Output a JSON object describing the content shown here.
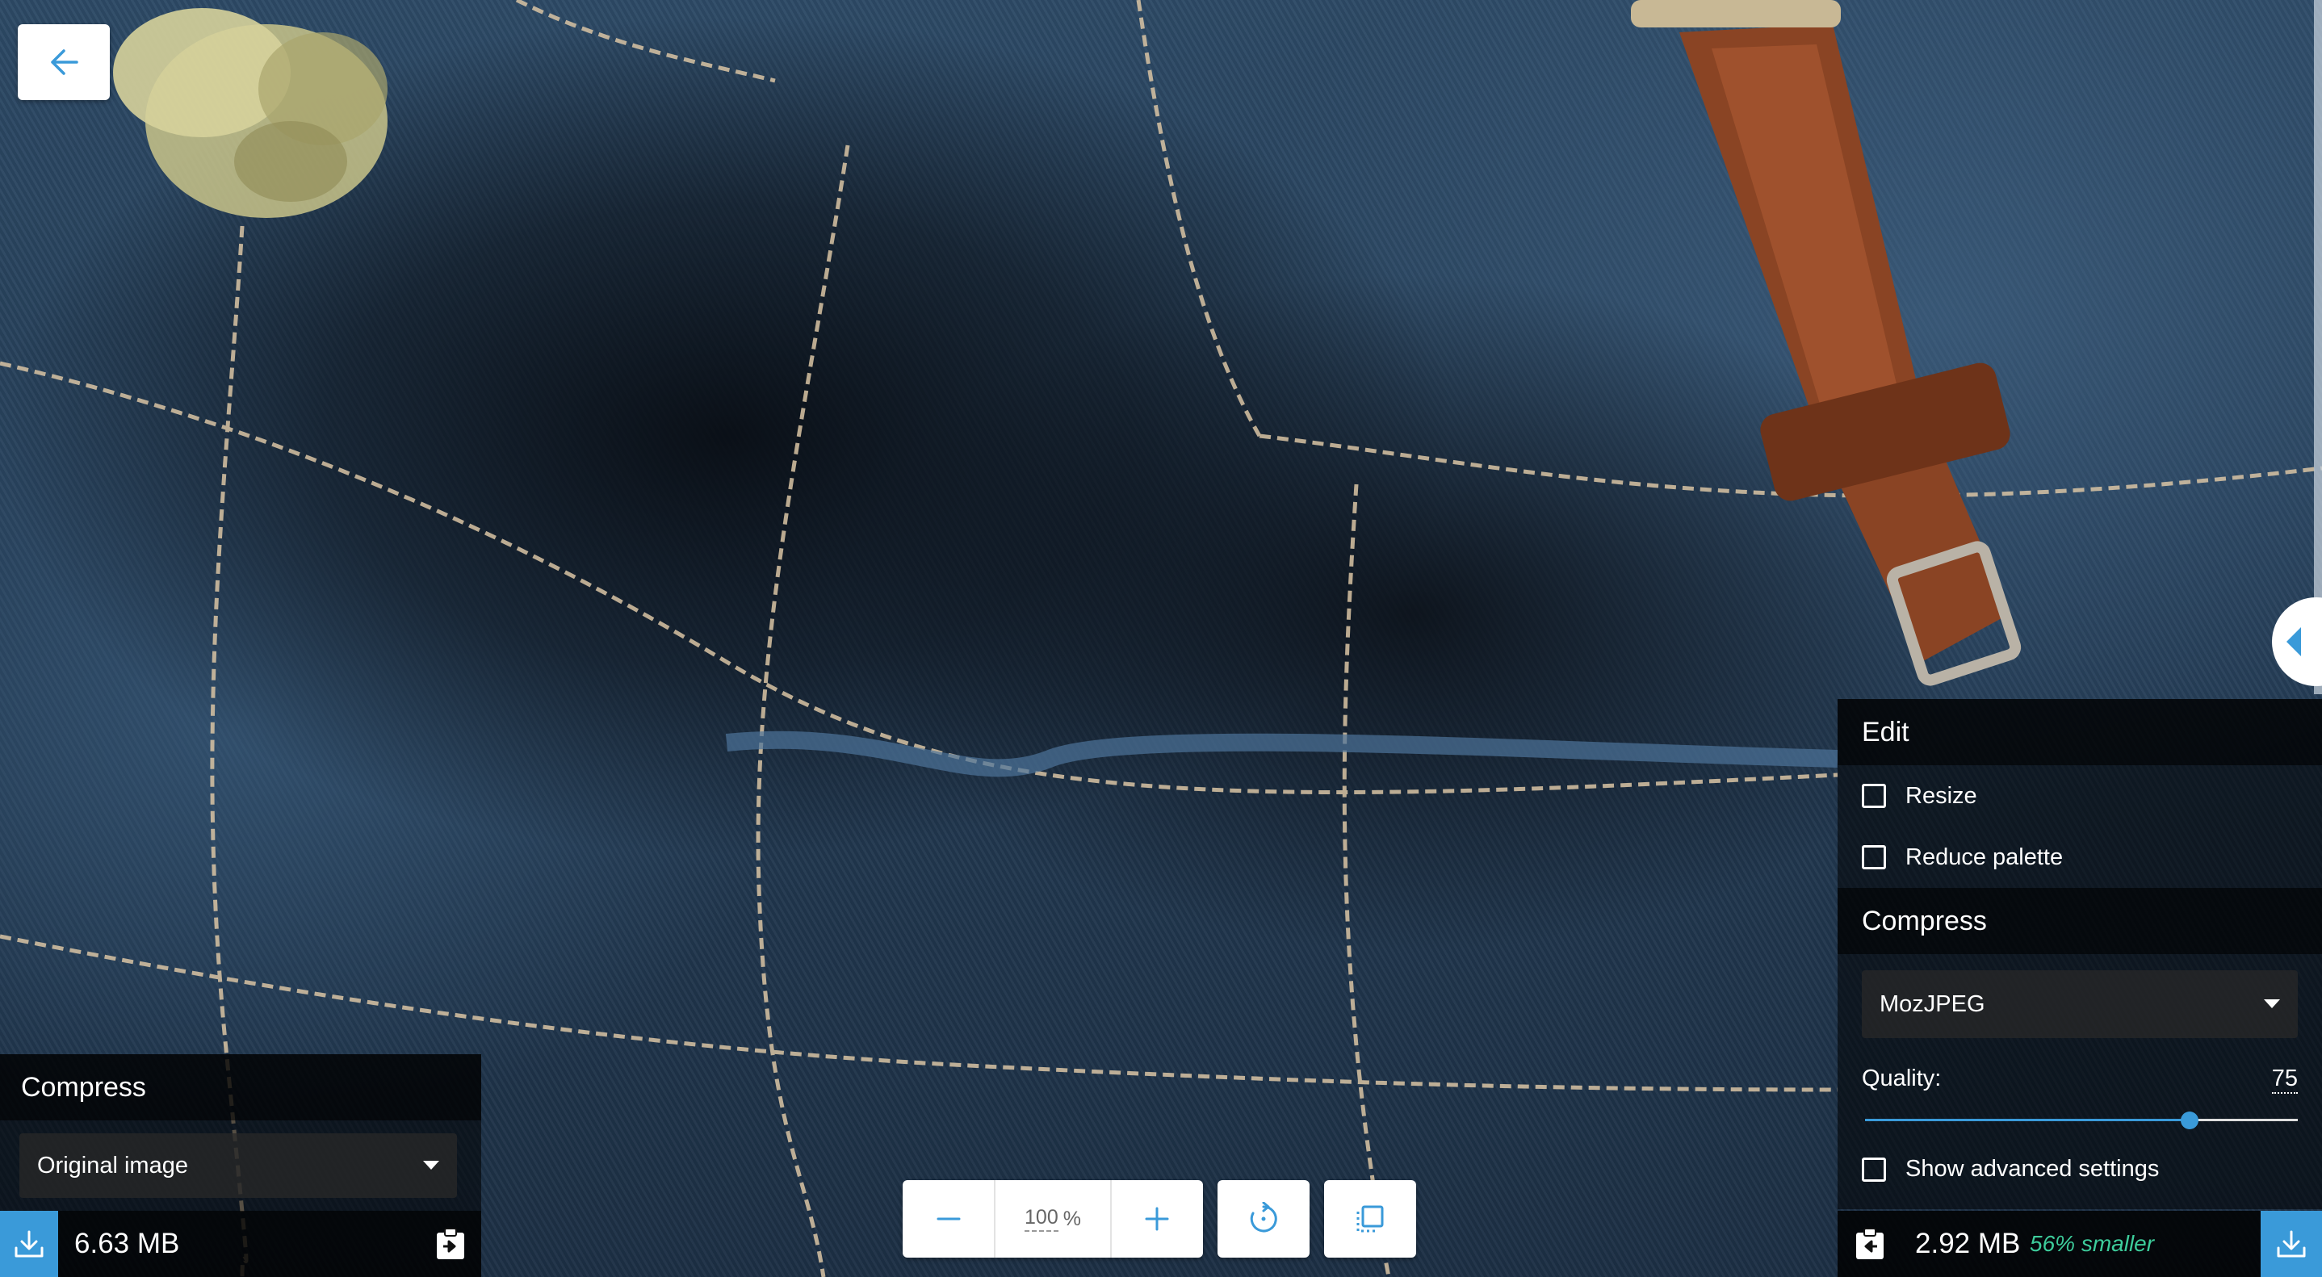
{
  "app": {
    "back_icon": "arrow-left-icon"
  },
  "left_panel": {
    "heading": "Compress",
    "encoder_selected": "Original image",
    "file_size": "6.63 MB"
  },
  "right_panel": {
    "edit_heading": "Edit",
    "options": [
      {
        "label": "Resize",
        "checked": false
      },
      {
        "label": "Reduce palette",
        "checked": false
      }
    ],
    "compress_heading": "Compress",
    "encoder_selected": "MozJPEG",
    "quality_label": "Quality:",
    "quality_value": "75",
    "quality_fraction": 0.75,
    "advanced_label": "Show advanced settings",
    "file_size": "2.92 MB",
    "savings": "56% smaller"
  },
  "toolbar": {
    "zoom_value": "100",
    "zoom_unit": "%",
    "icons": [
      "minus-icon",
      "plus-icon",
      "rotate-icon",
      "fit-screen-icon"
    ]
  },
  "colors": {
    "accent": "#3a9ad9",
    "savings_green": "#3dcc9b"
  }
}
